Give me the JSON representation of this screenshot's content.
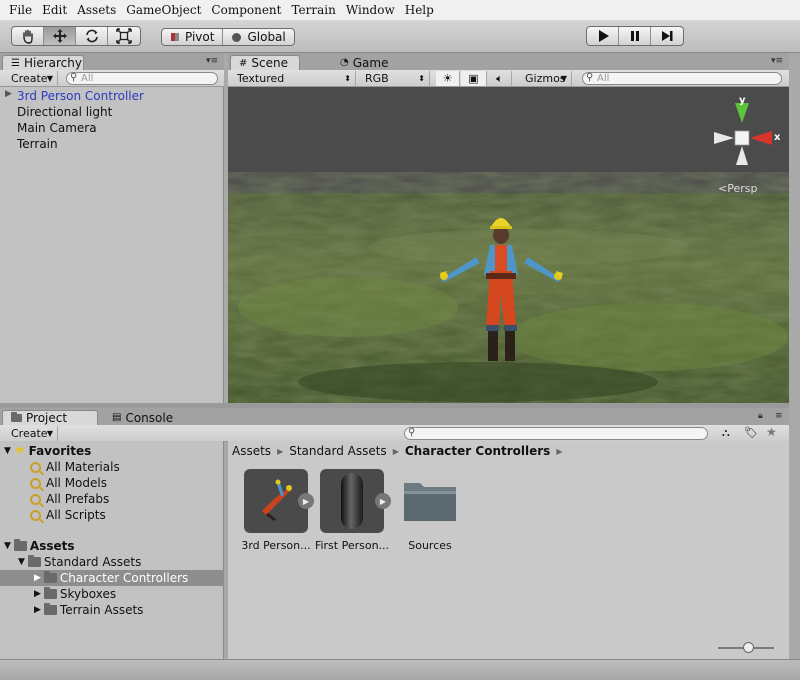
{
  "menu": [
    "File",
    "Edit",
    "Assets",
    "GameObject",
    "Component",
    "Terrain",
    "Window",
    "Help"
  ],
  "toolbar": {
    "tools": [
      "hand-icon",
      "move-icon",
      "rotate-icon",
      "scale-icon"
    ],
    "pivot_label": "Pivot",
    "global_label": "Global",
    "play_controls": [
      "play-icon",
      "pause-icon",
      "step-icon"
    ]
  },
  "hierarchy": {
    "tab_label": "Hierarchy",
    "create_label": "Create",
    "search_placeholder": "All",
    "items": [
      "3rd Person Controller",
      "Directional light",
      "Main Camera",
      "Terrain"
    ]
  },
  "scene": {
    "tab_scene": "Scene",
    "tab_game": "Game",
    "render_mode": "Textured",
    "color_mode": "RGB",
    "gizmos_label": "Gizmos",
    "search_placeholder": "All",
    "gizmo_y": "y",
    "gizmo_x": "x",
    "persp_label": "Persp"
  },
  "project": {
    "tab_project": "Project",
    "tab_console": "Console",
    "create_label": "Create",
    "favorites_label": "Favorites",
    "favorites": [
      "All Materials",
      "All Models",
      "All Prefabs",
      "All Scripts"
    ],
    "assets_label": "Assets",
    "standard_assets": "Standard Assets",
    "folders": [
      "Character Controllers",
      "Skyboxes",
      "Terrain Assets"
    ],
    "breadcrumb": [
      "Assets",
      "Standard Assets",
      "Character Controllers"
    ],
    "items": [
      "3rd Person...",
      "First Person...",
      "Sources"
    ]
  },
  "colors": {
    "selection": "#8e8e8e",
    "link": "#2b3cc0",
    "gizmo_y": "#5bc33a",
    "gizmo_x": "#d8352a"
  }
}
